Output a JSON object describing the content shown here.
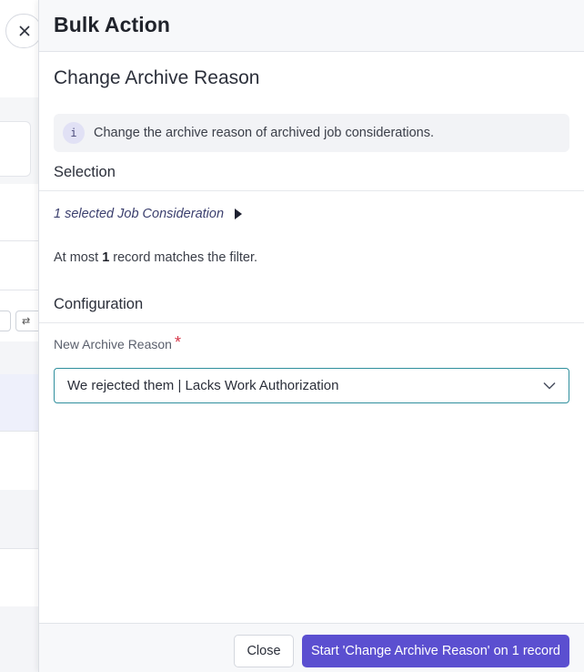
{
  "background": {
    "toolbar_button_partial": "⇄"
  },
  "drawer": {
    "title": "Bulk Action",
    "section_title": "Change Archive Reason",
    "info": {
      "icon_glyph": "i",
      "text": "Change the archive reason of archived job considerations."
    },
    "selection": {
      "heading": "Selection",
      "link_text": "1 selected Job Consideration",
      "match_prefix": "At most ",
      "match_count": "1",
      "match_suffix": " record matches the filter."
    },
    "configuration": {
      "heading": "Configuration",
      "field_label": "New Archive Reason",
      "required_mark": "*",
      "selected_value": "We rejected them | Lacks Work Authorization"
    },
    "footer": {
      "close_label": "Close",
      "primary_label": "Start 'Change Archive Reason' on 1 record"
    }
  },
  "colors": {
    "primary": "#5b4fd0",
    "focus_border": "#2f8f9d",
    "required": "#d6384a"
  }
}
